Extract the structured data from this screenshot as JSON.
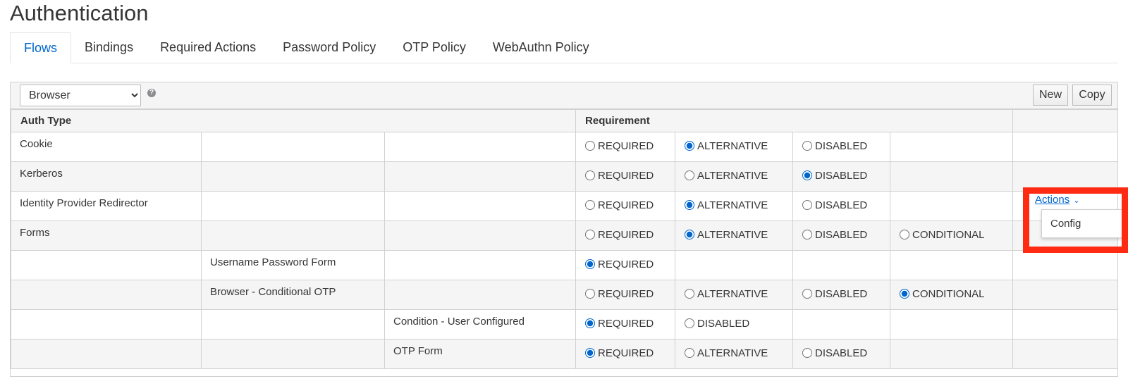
{
  "page": {
    "title": "Authentication"
  },
  "tabs": [
    {
      "label": "Flows",
      "active": true
    },
    {
      "label": "Bindings"
    },
    {
      "label": "Required Actions"
    },
    {
      "label": "Password Policy"
    },
    {
      "label": "OTP Policy"
    },
    {
      "label": "WebAuthn Policy"
    }
  ],
  "toolbar": {
    "flow_select": {
      "value": "Browser"
    },
    "help_icon": "question-circle-icon",
    "new_label": "New",
    "copy_label": "Copy"
  },
  "table": {
    "headers": {
      "auth_type": "Auth Type",
      "requirement": "Requirement"
    },
    "options": {
      "required": "REQUIRED",
      "alternative": "ALTERNATIVE",
      "disabled": "DISABLED",
      "conditional": "CONDITIONAL"
    },
    "rows": [
      {
        "name": "Cookie",
        "level": 0,
        "selected": "ALTERNATIVE"
      },
      {
        "name": "Kerberos",
        "level": 0,
        "selected": "DISABLED"
      },
      {
        "name": "Identity Provider Redirector",
        "level": 0,
        "selected": "ALTERNATIVE"
      },
      {
        "name": "Forms",
        "level": 0,
        "selected": "ALTERNATIVE"
      },
      {
        "name": "Username Password Form",
        "level": 1,
        "selected": "REQUIRED"
      },
      {
        "name": "Browser - Conditional OTP",
        "level": 1,
        "selected": "CONDITIONAL"
      },
      {
        "name": "Condition - User Configured",
        "level": 2,
        "selected": "REQUIRED"
      },
      {
        "name": "OTP Form",
        "level": 2,
        "selected": "REQUIRED"
      }
    ]
  },
  "actions": {
    "label": "Actions",
    "menu_item": "Config"
  },
  "colors": {
    "accent": "#0066cc",
    "highlight": "#ff2a12"
  }
}
